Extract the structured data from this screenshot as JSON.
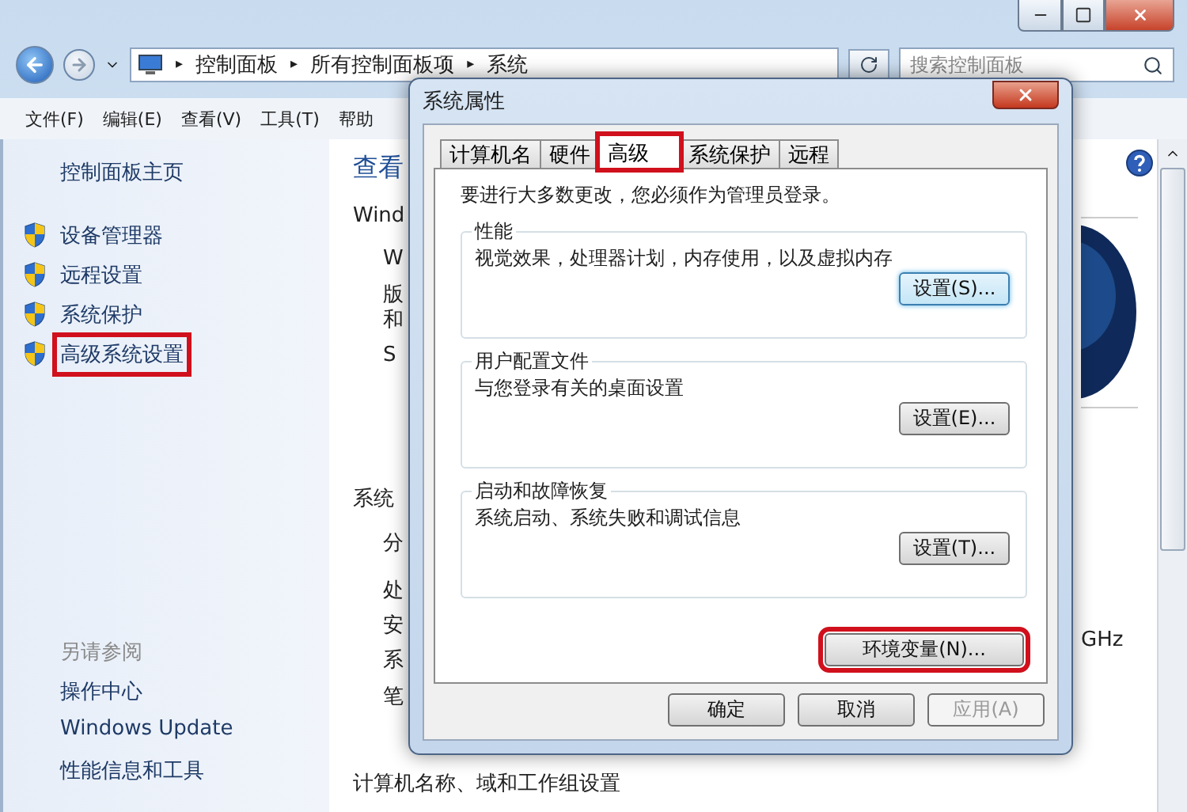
{
  "explorer": {
    "window_controls": [
      {
        "kind": "minimize"
      },
      {
        "kind": "maximize"
      },
      {
        "kind": "close"
      }
    ],
    "address_bar": {
      "crumbs": [
        "控制面板",
        "所有控制面板项",
        "系统"
      ],
      "separator": "▸"
    },
    "search": {
      "placeholder": "搜索控制面板"
    },
    "menu": [
      "文件(F)",
      "编辑(E)",
      "查看(V)",
      "工具(T)",
      "帮助"
    ],
    "sidebar": {
      "home": "控制面板主页",
      "tasks": [
        {
          "label": "设备管理器",
          "annotated": false
        },
        {
          "label": "远程设置",
          "annotated": false
        },
        {
          "label": "系统保护",
          "annotated": false
        },
        {
          "label": "高级系统设置",
          "annotated": true
        }
      ],
      "see_also": {
        "heading": "另请参阅",
        "links": [
          "操作中心",
          "Windows Update",
          "性能信息和工具"
        ]
      }
    },
    "content": {
      "fragments": [
        {
          "kind": "heading",
          "text": "查看"
        },
        {
          "kind": "section",
          "text": "Wind"
        },
        {
          "kind": "row",
          "text": "W"
        },
        {
          "kind": "row",
          "text": "版"
        },
        {
          "kind": "row",
          "text": "和"
        },
        {
          "kind": "row",
          "text": "S"
        },
        {
          "kind": "section",
          "text": "系统"
        },
        {
          "kind": "row",
          "text": "分"
        },
        {
          "kind": "row",
          "text": "处"
        },
        {
          "kind": "row",
          "text": "安"
        },
        {
          "kind": "row",
          "text": "系"
        },
        {
          "kind": "row",
          "text": "笔"
        },
        {
          "kind": "section",
          "text": "计算机名称、域和工作组设置"
        }
      ],
      "right_fragment": "GHz"
    }
  },
  "dialog": {
    "title": "系统属性",
    "tabs": [
      {
        "label": "计算机名",
        "selected": false,
        "annotated": false
      },
      {
        "label": "硬件",
        "selected": false,
        "annotated": false
      },
      {
        "label": "高级",
        "selected": true,
        "annotated": true
      },
      {
        "label": "系统保护",
        "selected": false,
        "annotated": false
      },
      {
        "label": "远程",
        "selected": false,
        "annotated": false
      }
    ],
    "note": "要进行大多数更改，您必须作为管理员登录。",
    "groups": [
      {
        "title": "性能",
        "description": "视觉效果，处理器计划，内存使用，以及虚拟内存",
        "button": "设置(S)...",
        "focused": true
      },
      {
        "title": "用户配置文件",
        "description": "与您登录有关的桌面设置",
        "button": "设置(E)...",
        "focused": false
      },
      {
        "title": "启动和故障恢复",
        "description": "系统启动、系统失败和调试信息",
        "button": "设置(T)...",
        "focused": false
      }
    ],
    "env_button": {
      "label": "环境变量(N)...",
      "annotated": true
    },
    "buttons": [
      {
        "label": "确定",
        "disabled": false
      },
      {
        "label": "取消",
        "disabled": false
      },
      {
        "label": "应用(A)",
        "disabled": true
      }
    ]
  }
}
